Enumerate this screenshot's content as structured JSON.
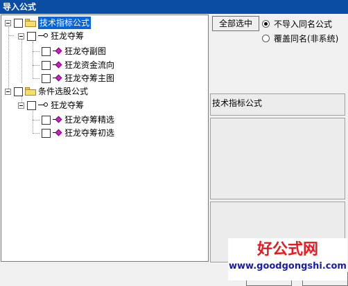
{
  "window": {
    "title": "导入公式"
  },
  "tree": {
    "root1": {
      "label": "技术指标公式",
      "child": {
        "label": "狂龙夺筹",
        "items": [
          "狂龙夺副图",
          "狂龙资金流向",
          "狂龙夺筹主图"
        ]
      }
    },
    "root2": {
      "label": "条件选股公式",
      "child": {
        "label": "狂龙夺筹",
        "items": [
          "狂龙夺筹精选",
          "狂龙夺筹初选"
        ]
      }
    }
  },
  "options": {
    "select_all_label": "全部选中",
    "radio1": {
      "label": "不导入同名公式",
      "selected": true
    },
    "radio2": {
      "label": "覆盖同名(非系统)",
      "selected": false
    }
  },
  "info": {
    "category": "技术指标公式"
  },
  "watermark": {
    "line1": "好公式网",
    "line2": "www.goodgongshi.com"
  }
}
